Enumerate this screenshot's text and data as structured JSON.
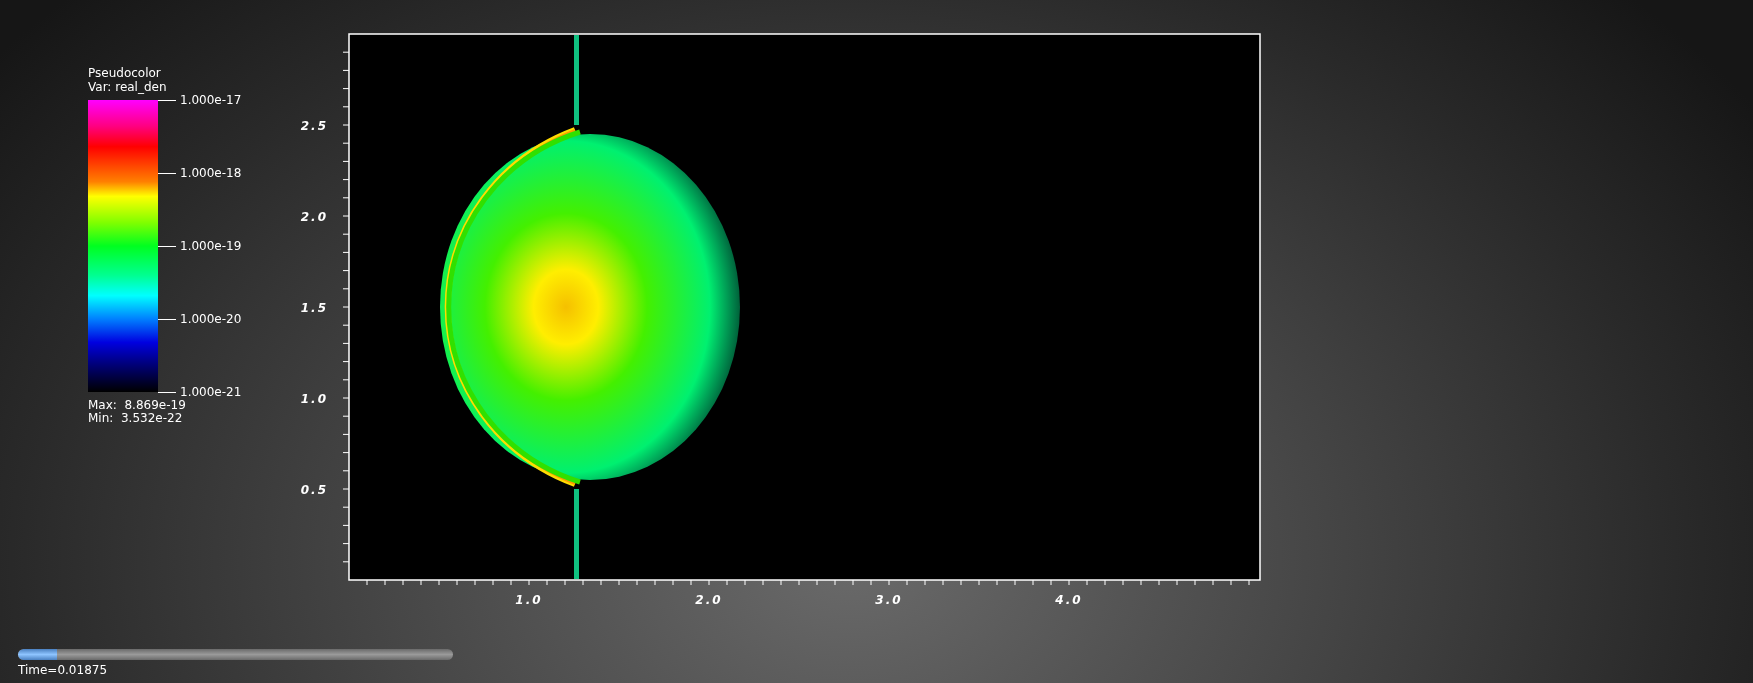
{
  "legend": {
    "title": "Pseudocolor",
    "variable": "Var: real_den",
    "labels": [
      "1.000e-17",
      "1.000e-18",
      "1.000e-19",
      "1.000e-20",
      "1.000e-21"
    ],
    "max": "Max:  8.869e-19",
    "min": "Min:  3.532e-22"
  },
  "plot": {
    "x_ticks": [
      "1.0",
      "2.0",
      "3.0",
      "4.0"
    ],
    "y_ticks": [
      "2.5",
      "2.0",
      "1.5",
      "1.0",
      "0.5"
    ]
  },
  "time_slider": {
    "level": 0.09,
    "label": "Time=0.01875"
  }
}
